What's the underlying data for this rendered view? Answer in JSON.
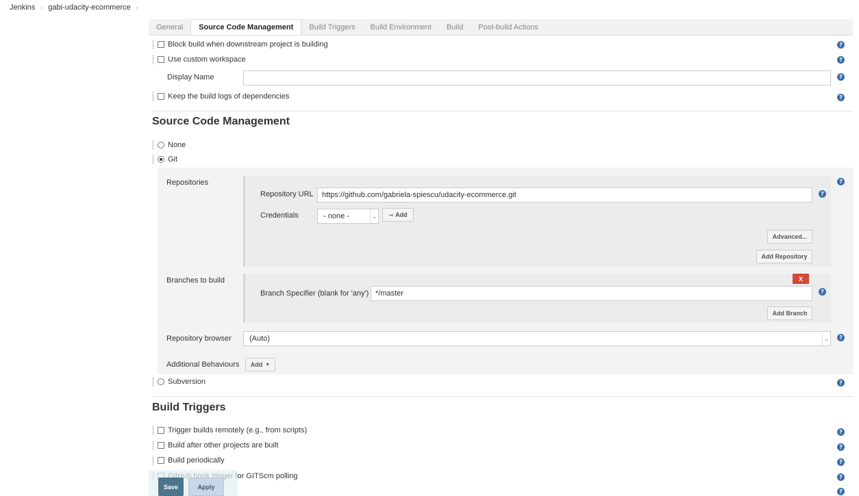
{
  "breadcrumb": {
    "root": "Jenkins",
    "project": "gabi-udacity-ecommerce"
  },
  "tabs": [
    {
      "label": "General"
    },
    {
      "label": "Source Code Management"
    },
    {
      "label": "Build Triggers"
    },
    {
      "label": "Build Environment"
    },
    {
      "label": "Build"
    },
    {
      "label": "Post-build Actions"
    }
  ],
  "general": {
    "block_downstream": "Block build when downstream project is building",
    "custom_workspace": "Use custom workspace",
    "display_name_label": "Display Name",
    "display_name_value": "",
    "keep_logs": "Keep the build logs of dependencies"
  },
  "scm": {
    "title": "Source Code Management",
    "none_label": "None",
    "git_label": "Git",
    "repositories_label": "Repositories",
    "repo_url_label": "Repository URL",
    "repo_url_value": "https://github.com/gabriela-spiescu/udacity-ecommerce.git",
    "credentials_label": "Credentials",
    "credentials_value": "- none -",
    "add_credentials": "Add",
    "advanced_button": "Advanced...",
    "add_repository_button": "Add Repository",
    "branches_label": "Branches to build",
    "branch_specifier_label": "Branch Specifier (blank for 'any')",
    "branch_specifier_value": "*/master",
    "delete_branch": "X",
    "add_branch_button": "Add Branch",
    "repo_browser_label": "Repository browser",
    "repo_browser_value": "(Auto)",
    "additional_behaviours_label": "Additional Behaviours",
    "add_behaviour_button": "Add",
    "subversion_label": "Subversion"
  },
  "triggers": {
    "title": "Build Triggers",
    "remote": "Trigger builds remotely (e.g., from scripts)",
    "after_other": "Build after other projects are built",
    "periodically": "Build periodically",
    "github_hook": "GitHub hook trigger for GITScm polling"
  },
  "footer": {
    "save": "Save",
    "apply": "Apply"
  },
  "icons": {
    "help": "?"
  }
}
